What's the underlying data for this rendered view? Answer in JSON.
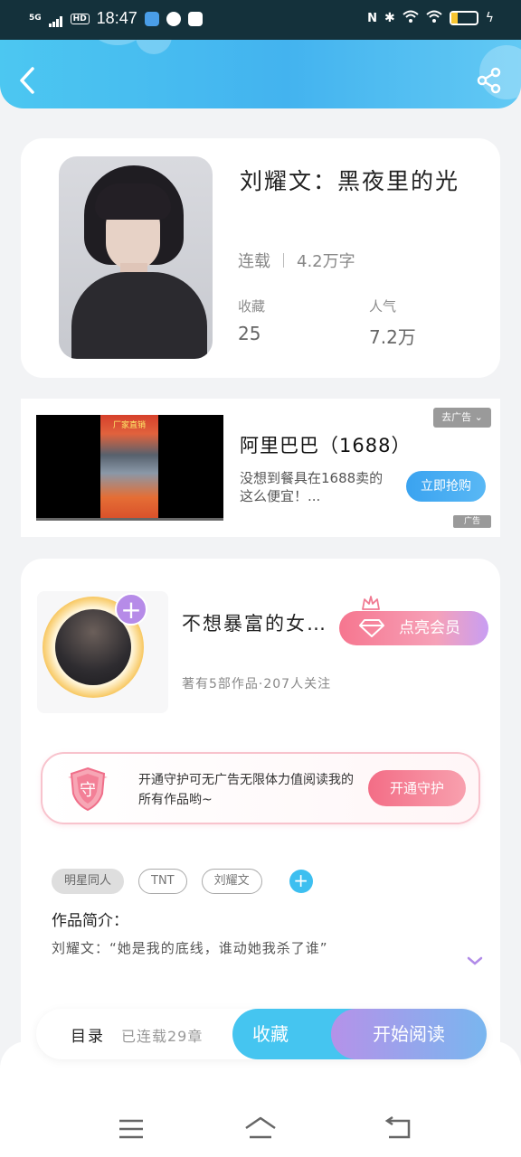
{
  "status_bar": {
    "network": "5G",
    "hd": "HD",
    "time": "18:47",
    "battery": "25"
  },
  "book": {
    "title": "刘耀文：黑夜里的光",
    "status": "连载",
    "word_count": "4.2万字",
    "favorites_label": "收藏",
    "favorites_value": "25",
    "popularity_label": "人气",
    "popularity_value": "7.2万"
  },
  "ad": {
    "video_caption": "厂家直销",
    "title": "阿里巴巴（1688）",
    "description": "没想到餐具在1688卖的这么便宜！...",
    "cta": "立即抢购",
    "tag": "去广告",
    "mark": "广告"
  },
  "author": {
    "name": "不想暴富的女…",
    "vip_label": "点亮会员",
    "subtitle": "著有5部作品·207人关注",
    "guard_text": "开通守护可无广告无限体力值阅读我的所有作品哟~",
    "guard_button": "开通守护",
    "guard_badge": "守"
  },
  "tags": [
    "明星同人",
    "TNT",
    "刘耀文"
  ],
  "intro": {
    "label": "作品简介：",
    "text": "刘耀文：“她是我的底线，谁动她我杀了谁”"
  },
  "bottom_bar": {
    "toc_label": "目录",
    "toc_sub": "已连载29章",
    "fav_button": "收藏",
    "read_button": "开始阅读"
  },
  "colors": {
    "header": "#43b3ef",
    "accent_blue": "#45c5f0",
    "vip_pink": "#f6768f",
    "guard_pink": "#f36d86",
    "read_purple": "#b592e9"
  }
}
